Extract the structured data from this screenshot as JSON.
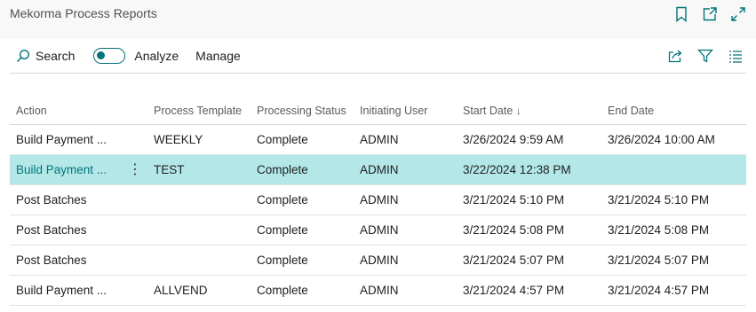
{
  "header": {
    "title": "Mekorma Process Reports",
    "icons": [
      "bookmark-icon",
      "open-new-window-icon",
      "expand-icon"
    ]
  },
  "toolbar": {
    "search_label": "Search",
    "analyze_label": "Analyze",
    "analyze_on": false,
    "manage_label": "Manage",
    "right_icons": [
      "share-icon",
      "filter-icon",
      "list-view-icon"
    ]
  },
  "table": {
    "columns": [
      "Action",
      "Process Template",
      "Processing Status",
      "Initiating User",
      "Start Date",
      "End Date"
    ],
    "sort_indicator": "↓",
    "rows": [
      {
        "action": "Build Payment ...",
        "template": "WEEKLY",
        "status": "Complete",
        "user": "ADMIN",
        "start": "3/26/2024 9:59 AM",
        "end": "3/26/2024 10:00 AM",
        "selected": false
      },
      {
        "action": "Build Payment ...",
        "template": "TEST",
        "status": "Complete",
        "user": "ADMIN",
        "start": "3/22/2024 12:38 PM",
        "end": "",
        "selected": true
      },
      {
        "action": "Post Batches",
        "template": "",
        "status": "Complete",
        "user": "ADMIN",
        "start": "3/21/2024 5:10 PM",
        "end": "3/21/2024 5:10 PM",
        "selected": false
      },
      {
        "action": "Post Batches",
        "template": "",
        "status": "Complete",
        "user": "ADMIN",
        "start": "3/21/2024 5:08 PM",
        "end": "3/21/2024 5:08 PM",
        "selected": false
      },
      {
        "action": "Post Batches",
        "template": "",
        "status": "Complete",
        "user": "ADMIN",
        "start": "3/21/2024 5:07 PM",
        "end": "3/21/2024 5:07 PM",
        "selected": false
      },
      {
        "action": "Build Payment ...",
        "template": "ALLVEND",
        "status": "Complete",
        "user": "ADMIN",
        "start": "3/21/2024 4:57 PM",
        "end": "3/21/2024 4:57 PM",
        "selected": false
      }
    ]
  },
  "colors": {
    "accent": "#00757a",
    "selected_row": "#b3e7e8"
  }
}
